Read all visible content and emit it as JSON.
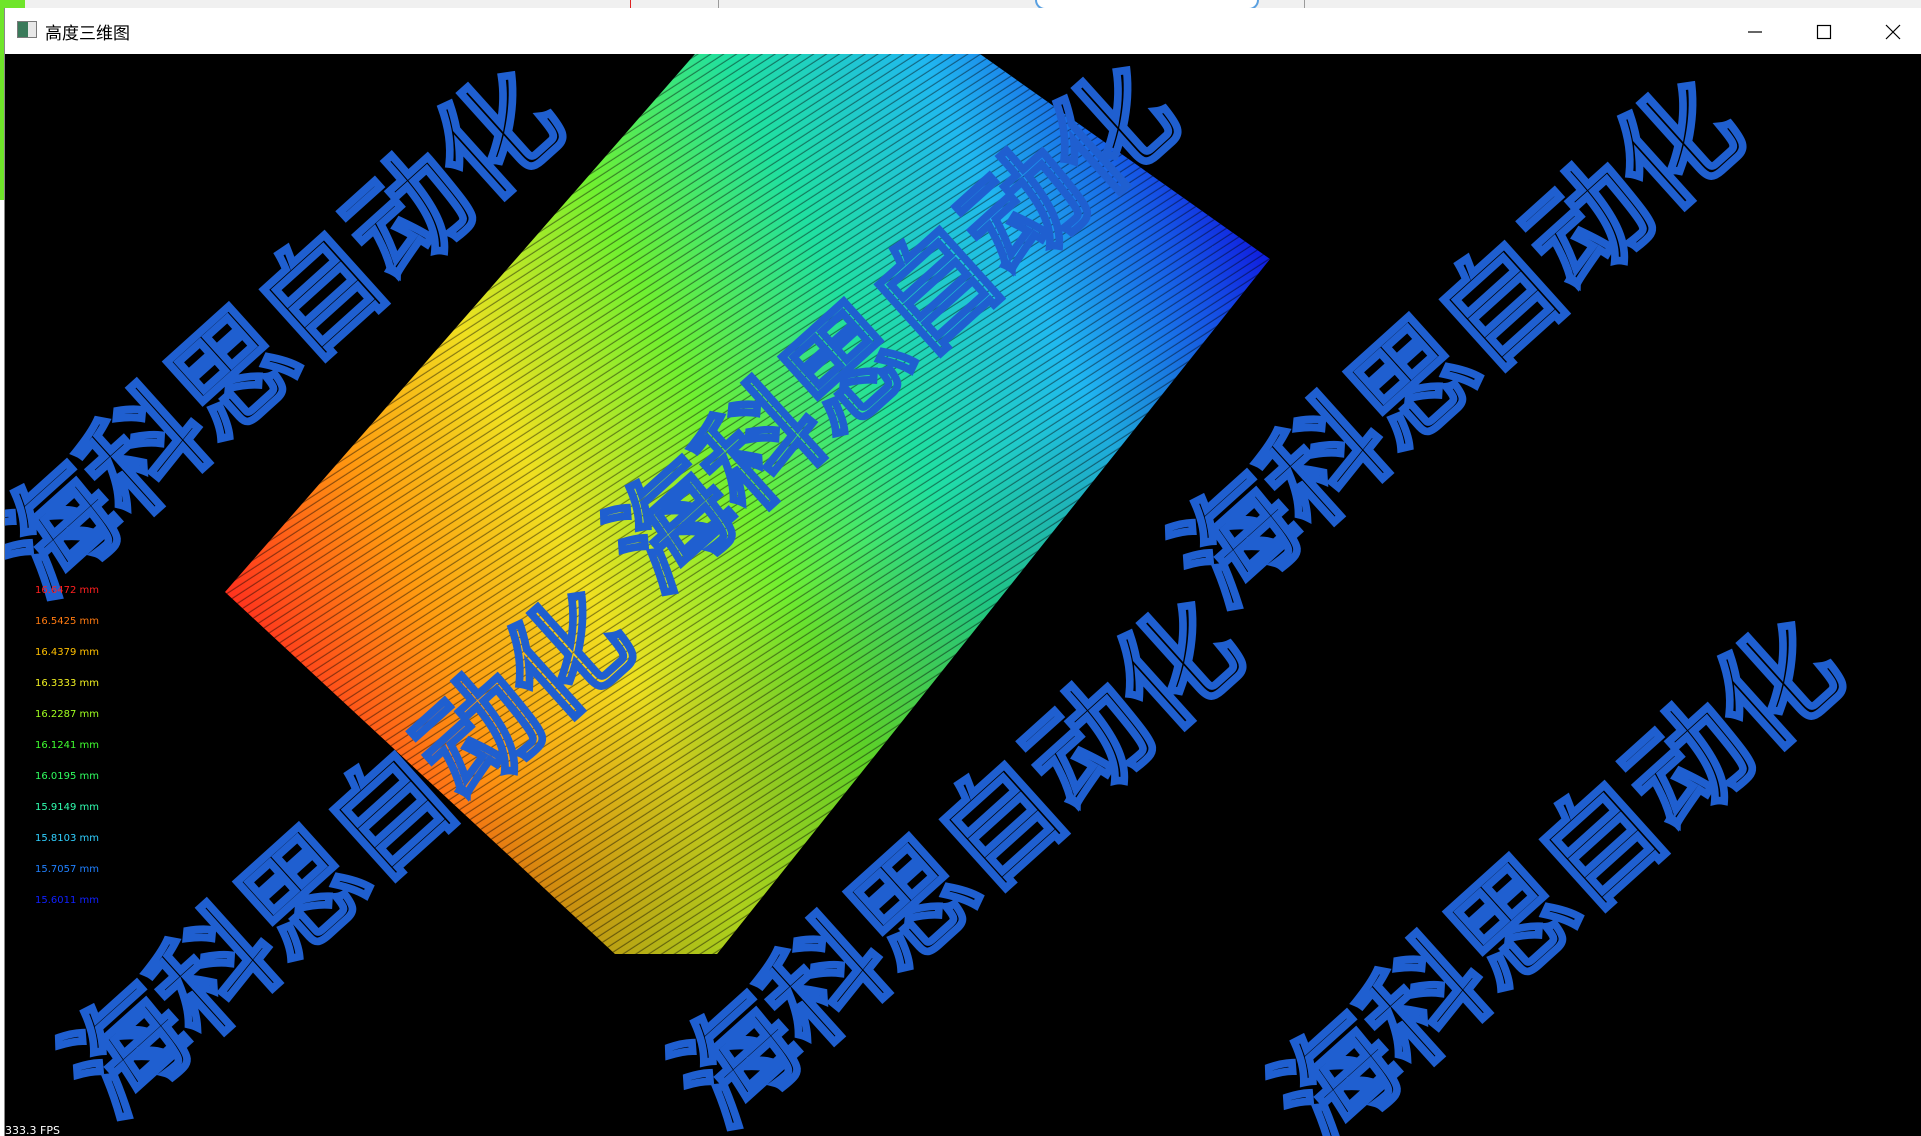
{
  "window": {
    "title": "高度三维图",
    "icon": "app-window-icon",
    "controls": {
      "minimize_icon": "minimize-icon",
      "maximize_icon": "maximize-icon",
      "close_icon": "close-icon"
    }
  },
  "viewport": {
    "background": "#000000",
    "watermark_text": "海科思自动化",
    "watermark_color": "#1f5fd0",
    "fps": "333.3 FPS"
  },
  "legend": [
    {
      "label": "16.6472 mm",
      "color": "#ff2020"
    },
    {
      "label": "16.5425 mm",
      "color": "#ff7a10"
    },
    {
      "label": "16.4379 mm",
      "color": "#ffc000"
    },
    {
      "label": "16.3333 mm",
      "color": "#f0f020"
    },
    {
      "label": "16.2287 mm",
      "color": "#a0ff20"
    },
    {
      "label": "16.1241 mm",
      "color": "#40ff30"
    },
    {
      "label": "16.0195 mm",
      "color": "#30ff60"
    },
    {
      "label": "15.9149 mm",
      "color": "#30ffb0"
    },
    {
      "label": "15.8103 mm",
      "color": "#30d0ff"
    },
    {
      "label": "15.7057 mm",
      "color": "#2080ff"
    },
    {
      "label": "15.6011 mm",
      "color": "#1020ff"
    }
  ]
}
